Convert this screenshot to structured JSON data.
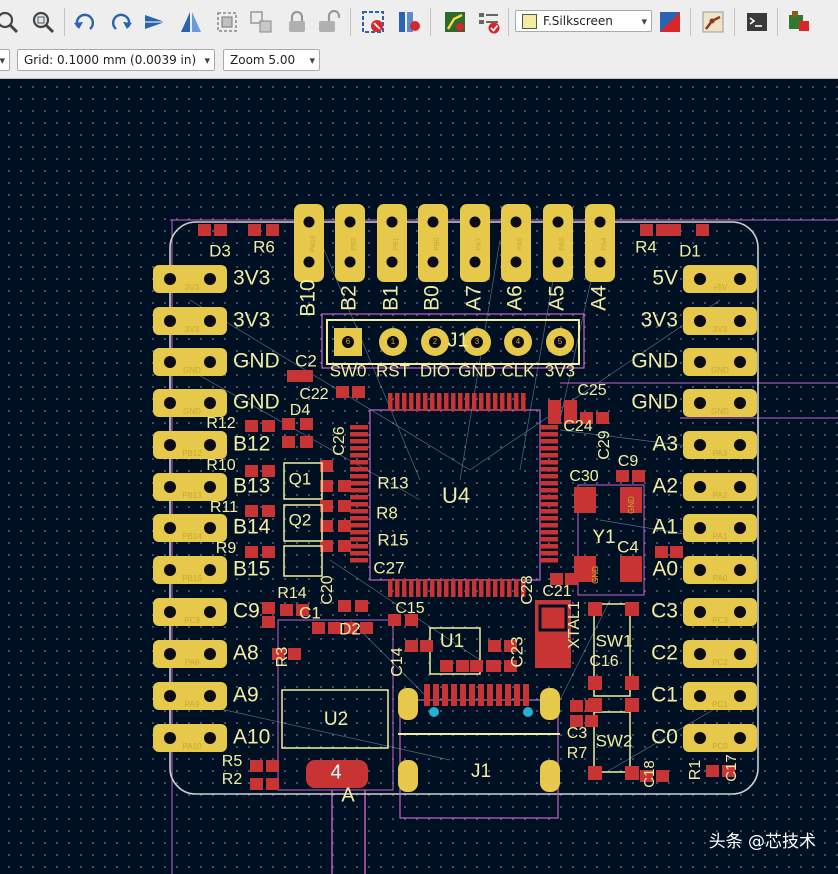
{
  "toolbar": {
    "icons": [
      "zoom-fit-icon",
      "zoom-area-icon",
      "undo-rotate-icon",
      "redo-rotate-icon",
      "flip-icon",
      "mirror-icon",
      "group-icon",
      "ungroup-icon",
      "lock-icon",
      "unlock-icon",
      "net-highlight-icon",
      "inspect-icon",
      "route-icon",
      "drc-icon",
      "layer-pair-icon",
      "footprint-editor-icon",
      "scripting-console-icon",
      "board-setup-icon"
    ],
    "layer_select": "F.Silkscreen",
    "layer_color": "#f2eda1"
  },
  "subtoolbar": {
    "grid": "Grid: 0.1000 mm (0.0039 in)",
    "zoom": "Zoom 5.00"
  },
  "colors": {
    "background": "#001023",
    "copper": "#c83434",
    "pad": "#e6c84a",
    "silk": "#f2eda1",
    "courtyard": "#c864c8",
    "board_edge": "#d0d0d0",
    "ratsnest": "#a0b4c8"
  },
  "board": {
    "left_labels": [
      "3V3",
      "3V3",
      "GND",
      "GND",
      "B12",
      "B13",
      "B14",
      "B15",
      "C9",
      "A8",
      "A9",
      "A10"
    ],
    "right_labels": [
      "5V",
      "3V3",
      "GND",
      "GND",
      "A3",
      "A2",
      "A1",
      "A0",
      "C3",
      "C2",
      "C1",
      "C0"
    ],
    "left_pad_nets": [
      "3V3",
      "3V3",
      "GND",
      "GND",
      "PB12",
      "PB13",
      "PB14",
      "PB15",
      "PC9",
      "PA8",
      "PA9",
      "PA10"
    ],
    "right_pad_nets": [
      "+5V",
      "3V3",
      "GND",
      "GND",
      "PA3",
      "PA2",
      "PA1",
      "PA0",
      "PC3",
      "PC2",
      "PC1",
      "PC0"
    ],
    "top_labels": [
      "B10",
      "B2",
      "B1",
      "B0",
      "A7",
      "A6",
      "A5",
      "A4"
    ],
    "top_pad_nets": [
      "PB10",
      "PB2",
      "PB1",
      "PB0",
      "PA7",
      "PA6",
      "PA5",
      "PA4"
    ],
    "header_labels": [
      "SW0",
      "RST",
      "DIO",
      "GND",
      "CLK",
      "3V3"
    ],
    "header_ref": "J1",
    "refs": [
      "D3",
      "R6",
      "R4",
      "D1",
      "C2",
      "C22",
      "D4",
      "R12",
      "C26",
      "R10",
      "Q1",
      "R11",
      "Q2",
      "R9",
      "R13",
      "R8",
      "R15",
      "C27",
      "R14",
      "C20",
      "C1",
      "D2",
      "R3",
      "C15",
      "U4",
      "C25",
      "C24",
      "C29",
      "C9",
      "C30",
      "Y1",
      "C4",
      "C21",
      "C28",
      "C23",
      "XTAL1",
      "SW1",
      "C16",
      "C14",
      "U1",
      "U2",
      "C3",
      "R7",
      "SW2",
      "C18",
      "R1",
      "C17",
      "R5",
      "R2",
      "J1",
      "4",
      "A"
    ],
    "extra_pad_labels": [
      "1",
      "2",
      "3",
      "4",
      "5",
      "6",
      "GND",
      "GND"
    ]
  },
  "watermark": "头条 @芯技术"
}
